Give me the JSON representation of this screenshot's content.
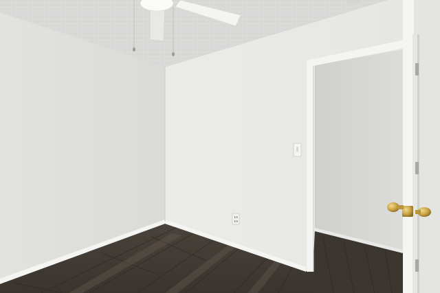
{
  "scene": {
    "kind": "photo",
    "subject": "empty-bedroom"
  },
  "colors": {
    "ceiling": "#dcdcda",
    "left_wall": "#e4e4e2",
    "back_wall": "#ececea",
    "closet_wall": "#d6d6d4",
    "trim": "#f4f4f2",
    "floor_dark": "#3e3832",
    "floor_mid": "#5a524a",
    "brass": "#c9a445"
  },
  "icons": [
    "ceiling-fan-icon",
    "light-switch-icon",
    "power-outlet-icon",
    "door-knob-icon"
  ]
}
